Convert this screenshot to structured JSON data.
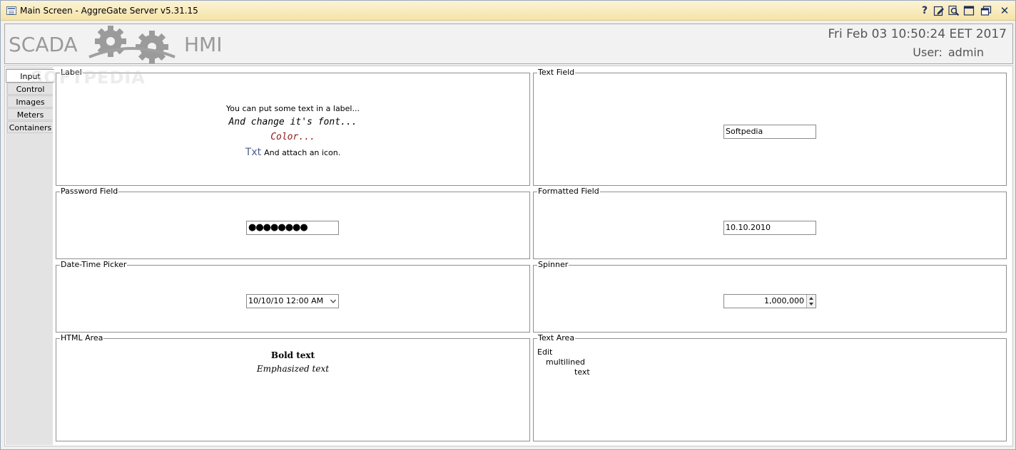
{
  "window": {
    "title": "Main Screen - AggreGate Server v5.31.15"
  },
  "header": {
    "logo_left": "SCADA",
    "logo_right": "HMI",
    "datetime": "Fri Feb 03 10:50:24 EET 2017",
    "user_label": "User:",
    "user_name": "admin"
  },
  "watermark": "SOFTPEDIA",
  "sidebar": {
    "tabs": [
      {
        "label": "Input",
        "active": true
      },
      {
        "label": "Control",
        "active": false
      },
      {
        "label": "Images",
        "active": false
      },
      {
        "label": "Meters",
        "active": false
      },
      {
        "label": "Containers",
        "active": false
      }
    ]
  },
  "panels": {
    "label": {
      "title": "Label",
      "line1": "You can put some text in a label...",
      "line2": "And change it's font...",
      "line3": "Color...",
      "line3_color": "#8b1a1a",
      "icon_text": "Txt",
      "line4": "And attach an icon."
    },
    "text_field": {
      "title": "Text Field",
      "value": "Softpedia"
    },
    "password_field": {
      "title": "Password Field",
      "value": "●●●●●●●●"
    },
    "formatted_field": {
      "title": "Formatted Field",
      "value": "10.10.2010"
    },
    "datetime_picker": {
      "title": "Date-Time Picker",
      "value": "10/10/10 12:00 AM"
    },
    "spinner": {
      "title": "Spinner",
      "value": "1,000,000"
    },
    "html_area": {
      "title": "HTML Area",
      "bold_text": "Bold text",
      "em_text": "Emphasized text"
    },
    "text_area": {
      "title": "Text Area",
      "line1": "Edit",
      "line2": "multilined",
      "line3": "text"
    }
  },
  "icons": {
    "help": "help-icon",
    "edit": "edit-icon",
    "search": "search-icon",
    "maximize": "maximize-icon",
    "restore": "restore-icon",
    "close": "close-icon"
  }
}
